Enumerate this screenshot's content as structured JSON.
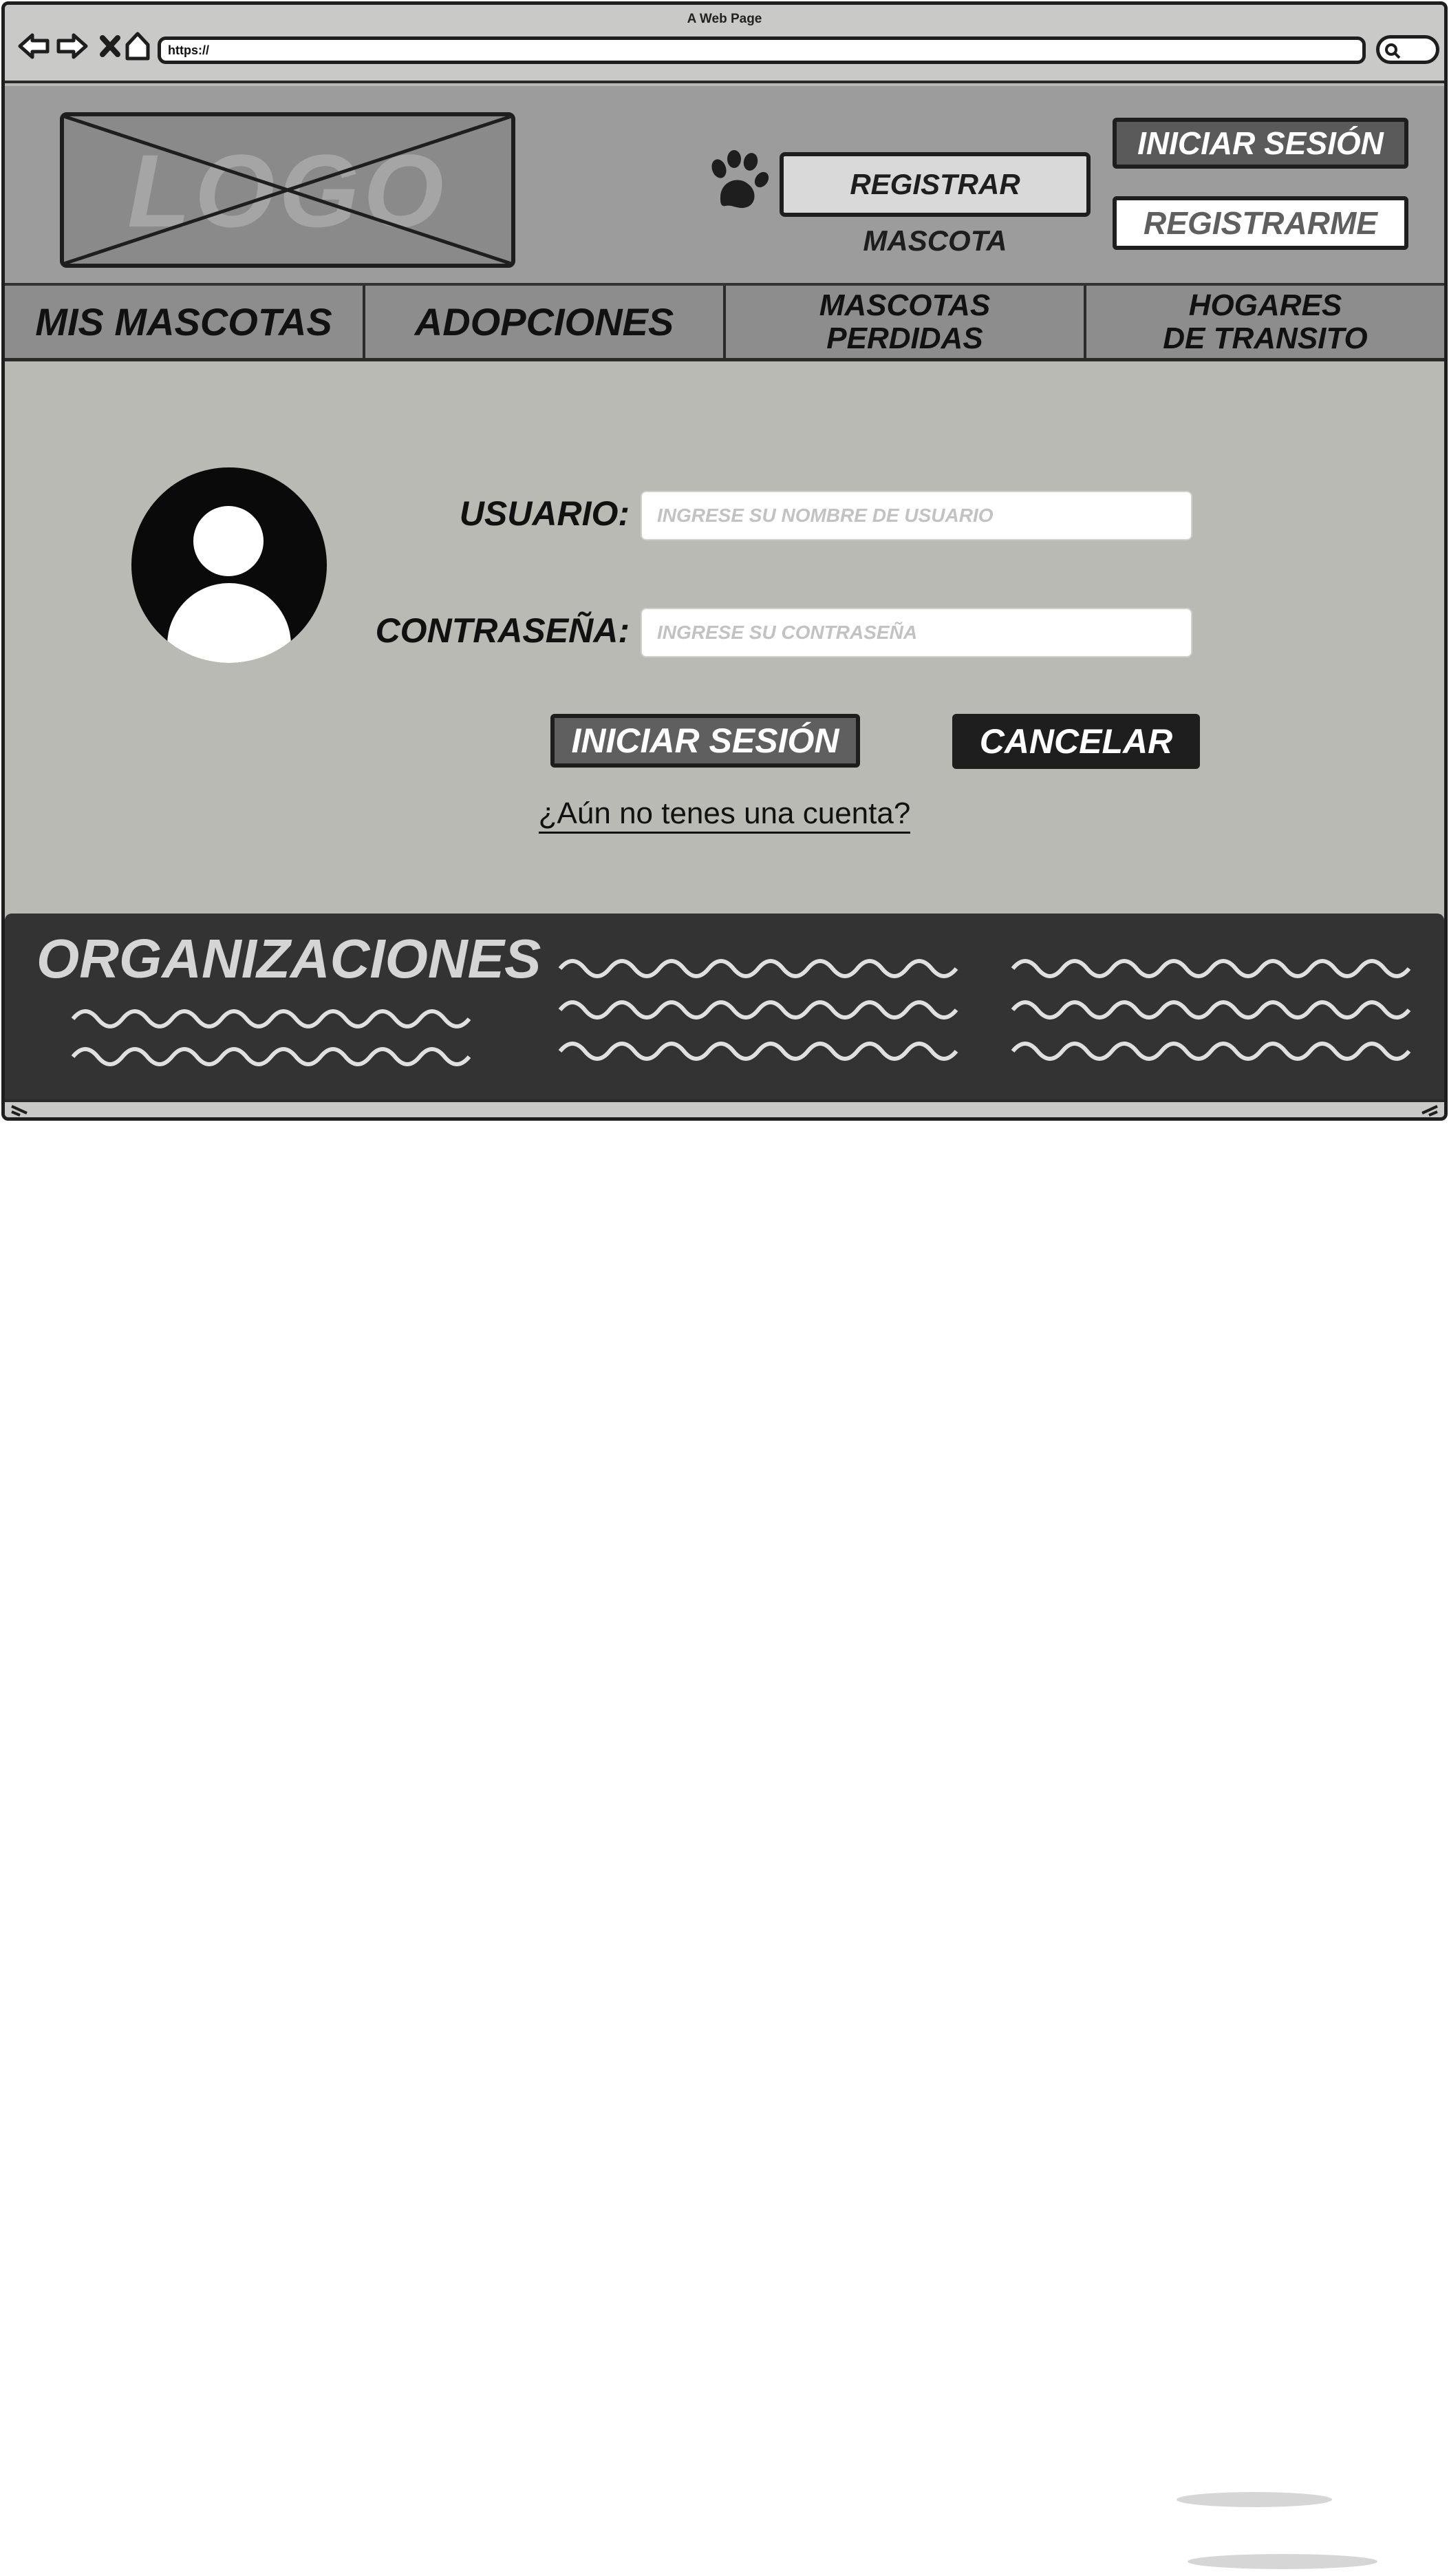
{
  "window": {
    "title": "A Web Page",
    "address": "https://"
  },
  "header": {
    "logo_text": "LOGO",
    "register_pet_label": "REGISTRAR MASCOTA",
    "login_label": "INICIAR SESIÓN",
    "signup_label": "REGISTRARME"
  },
  "menu": {
    "items": [
      {
        "label": "MIS MASCOTAS"
      },
      {
        "label": "ADOPCIONES"
      },
      {
        "label": "MASCOTAS\nPERDIDAS"
      },
      {
        "label": "HOGARES\nDE TRANSITO"
      }
    ]
  },
  "login_form": {
    "username_label": "USUARIO:",
    "username_placeholder": "INGRESE SU NOMBRE DE USUARIO",
    "password_label": "CONTRASEÑA:",
    "password_placeholder": "INGRESE SU CONTRASEÑA",
    "submit_label": "INICIAR SESIÓN",
    "cancel_label": "CANCELAR",
    "no_account_link": "¿Aún no tenes una cuenta?"
  },
  "footer": {
    "title": "ORGANIZACIONES"
  },
  "colors": {
    "page_bg": "#b9bab3",
    "header_bg": "#9c9c9c",
    "menu_bg": "#8d8d8d",
    "footer_bg": "#333333",
    "dark_button": "#1e1e1e",
    "mid_button": "#5a5a5a"
  },
  "icons": [
    "back-arrow-icon",
    "forward-arrow-icon",
    "close-icon",
    "home-icon",
    "search-icon",
    "paw-icon",
    "user-avatar-icon",
    "resize-icon"
  ]
}
